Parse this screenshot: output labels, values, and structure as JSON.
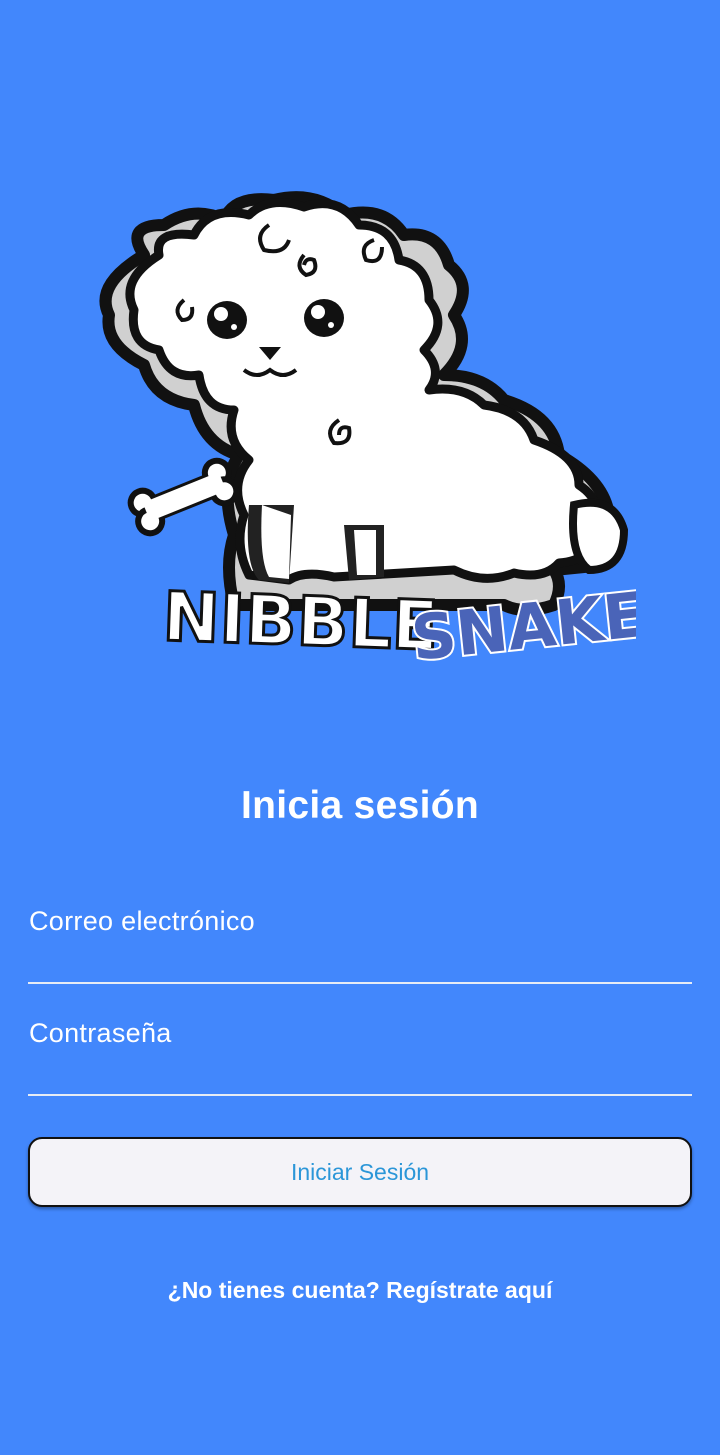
{
  "logo": {
    "word1": "NIBBLE",
    "word2": "SNAKE",
    "icon": "poodle-dog-logo"
  },
  "login": {
    "title": "Inicia sesión",
    "email_label": "Correo electrónico",
    "email_value": "",
    "password_label": "Contraseña",
    "password_value": "",
    "submit_label": "Iniciar Sesión",
    "register_link": "¿No tienes cuenta? Regístrate aquí"
  },
  "colors": {
    "background": "#4287fc",
    "button_bg": "#f4f3f8",
    "button_text": "#2b96d8",
    "logo_snake": "#4a64b8"
  }
}
